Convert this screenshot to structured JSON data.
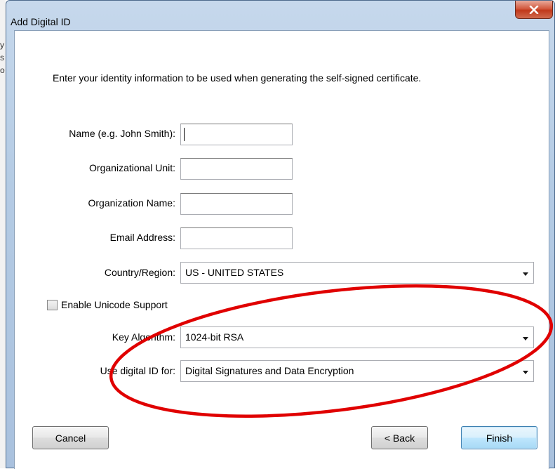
{
  "window": {
    "title": "Add Digital ID"
  },
  "intro_text": "Enter your identity information to be used when generating the self-signed certificate.",
  "fields": {
    "name": {
      "label": "Name (e.g. John Smith):",
      "value": ""
    },
    "org_unit": {
      "label": "Organizational Unit:",
      "value": ""
    },
    "org_name": {
      "label": "Organization Name:",
      "value": ""
    },
    "email": {
      "label": "Email Address:",
      "value": ""
    }
  },
  "country": {
    "label": "Country/Region:",
    "value": "US - UNITED STATES"
  },
  "unicode": {
    "label": "Enable Unicode Support",
    "checked": false
  },
  "key_algorithm": {
    "label": "Key Algorithm:",
    "value": "1024-bit RSA"
  },
  "use_for": {
    "label": "Use digital ID for:",
    "value": "Digital Signatures and Data Encryption"
  },
  "buttons": {
    "cancel": "Cancel",
    "back": "< Back",
    "finish": "Finish"
  },
  "annotation": {
    "shape": "ellipse",
    "color": "#e00000"
  },
  "colors": {
    "accent": "#3c7fb1",
    "close": "#c0391b"
  }
}
